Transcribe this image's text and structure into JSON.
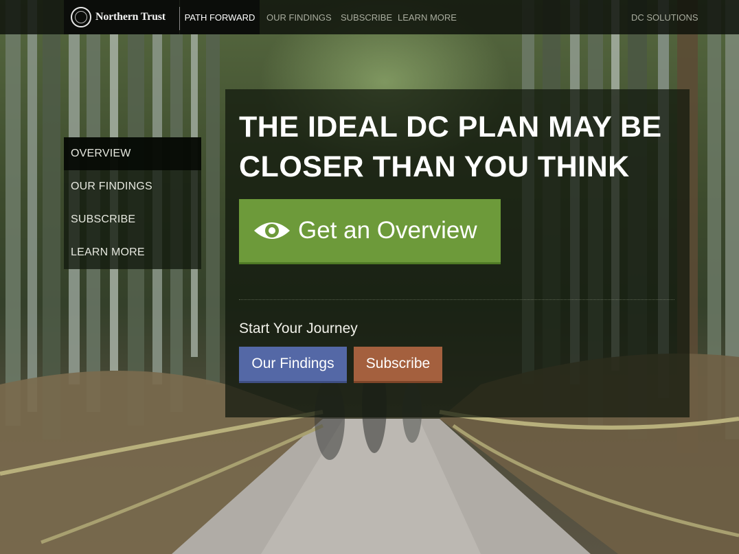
{
  "brand": {
    "name": "Northern Trust",
    "logo_icon": "seal-icon"
  },
  "topnav": {
    "active": "PATH FORWARD",
    "links": [
      "OUR FINDINGS",
      "SUBSCRIBE",
      "LEARN MORE"
    ],
    "right_link": "DC SOLUTIONS"
  },
  "sidemenu": {
    "items": [
      {
        "label": "OVERVIEW",
        "active": true
      },
      {
        "label": "OUR FINDINGS",
        "active": false
      },
      {
        "label": "SUBSCRIBE",
        "active": false
      },
      {
        "label": "LEARN MORE",
        "active": false
      }
    ]
  },
  "hero": {
    "headline_line1": "THE IDEAL DC PLAN MAY BE",
    "headline_line2": "CLOSER THAN YOU THINK",
    "cta_label": "Get an Overview",
    "cta_icon": "eye-icon",
    "journey_label": "Start Your Journey",
    "findings_button": "Our Findings",
    "subscribe_button": "Subscribe"
  },
  "colors": {
    "cta_green": "#6d9a3a",
    "findings_blue": "#5468a6",
    "subscribe_rust": "#a4603e",
    "nav_bg": "#0b0d0a"
  }
}
